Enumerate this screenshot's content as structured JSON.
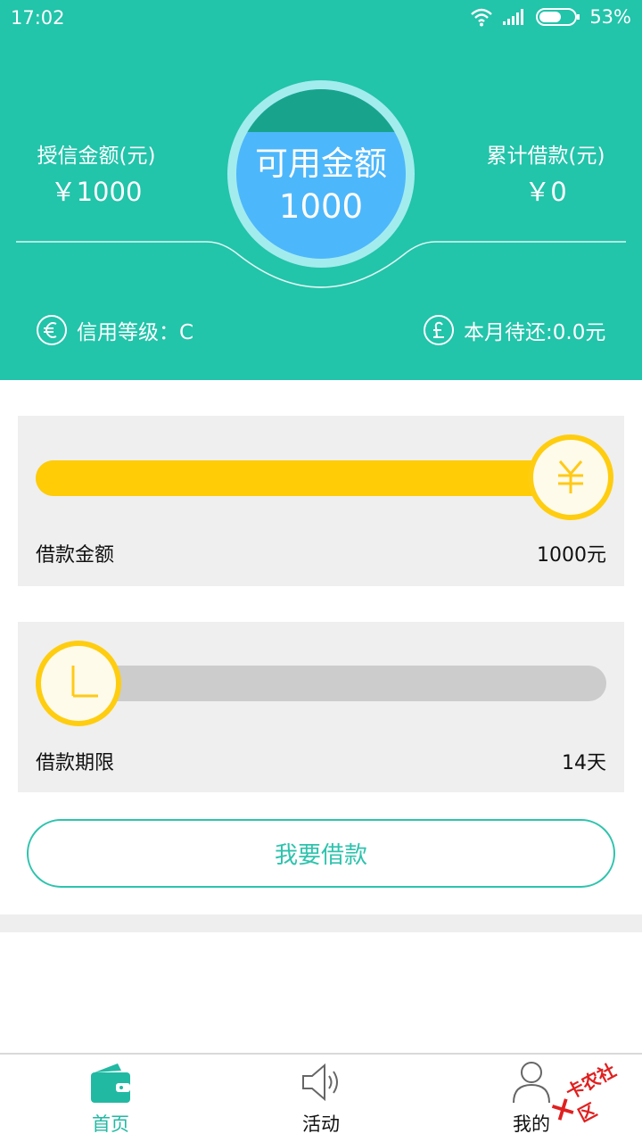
{
  "status_bar": {
    "time": "17:02",
    "battery": "53%",
    "icons": [
      "wifi-icon",
      "signal-icon",
      "battery-icon"
    ]
  },
  "summary": {
    "credit_label": "授信金额(元)",
    "credit_value": "￥1000",
    "available_label": "可用金额",
    "available_value": "1000",
    "borrowed_label": "累计借款(元)",
    "borrowed_value": "￥0"
  },
  "info": {
    "credit_level": "信用等级：C",
    "monthly_due": "本月待还:0.0元",
    "credit_icon": "euro-icon",
    "due_icon": "pound-icon"
  },
  "amount_slider": {
    "label": "借款金额",
    "value": "1000元",
    "level": 1.0,
    "knob_icon": "yen-icon"
  },
  "term_slider": {
    "label": "借款期限",
    "value": "14天",
    "level": 0.0,
    "knob_icon": "clock-icon"
  },
  "apply_button": "我要借款",
  "tabs": [
    {
      "label": "首页",
      "icon": "wallet-icon",
      "active": true
    },
    {
      "label": "活动",
      "icon": "speaker-icon",
      "active": false
    },
    {
      "label": "我的",
      "icon": "user-icon",
      "active": false
    }
  ],
  "watermark": "卡农社区",
  "colors": {
    "header": "#22c4aa",
    "accent": "#2ec3ad",
    "slider_fill": "#ffcc05",
    "circle_blue": "#4db7fb",
    "circle_top": "#18a48c"
  }
}
